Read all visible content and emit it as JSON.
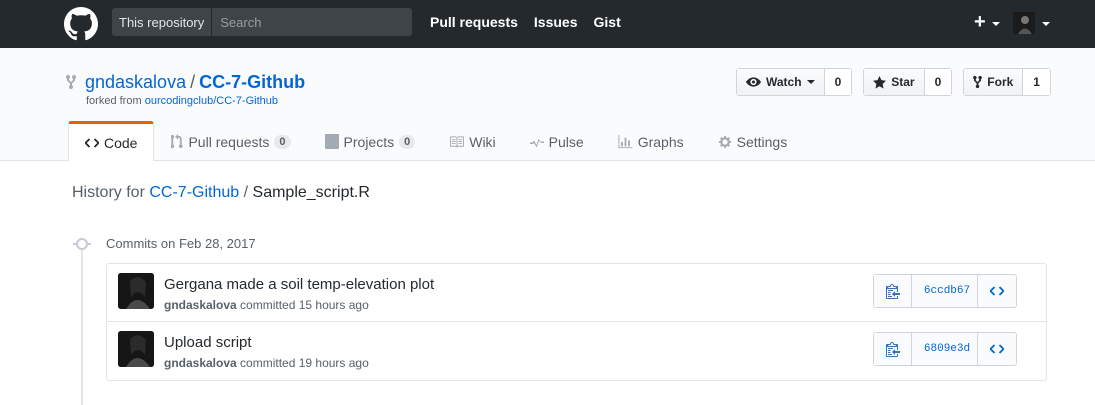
{
  "header": {
    "search_scope": "This repository",
    "search_placeholder": "Search",
    "nav": [
      "Pull requests",
      "Issues",
      "Gist"
    ]
  },
  "repo": {
    "owner": "gndaskalova",
    "separator": "/",
    "name": "CC-7-Github",
    "forked_prefix": "forked from",
    "forked_from": "ourcodingclub/CC-7-Github"
  },
  "actions": {
    "watch_label": "Watch",
    "watch_count": "0",
    "star_label": "Star",
    "star_count": "0",
    "fork_label": "Fork",
    "fork_count": "1"
  },
  "tabs": [
    {
      "label": "Code",
      "counter": null,
      "selected": true
    },
    {
      "label": "Pull requests",
      "counter": "0"
    },
    {
      "label": "Projects",
      "counter": "0"
    },
    {
      "label": "Wiki"
    },
    {
      "label": "Pulse"
    },
    {
      "label": "Graphs"
    },
    {
      "label": "Settings"
    }
  ],
  "history": {
    "prefix": "History for",
    "repo": "CC-7-Github",
    "separator": "/",
    "file": "Sample_script.R"
  },
  "commits_date": "Commits on Feb 28, 2017",
  "commits": [
    {
      "title": "Gergana made a soil temp-elevation plot",
      "author": "gndaskalova",
      "meta": "committed 15 hours ago",
      "sha": "6ccdb67"
    },
    {
      "title": "Upload script",
      "author": "gndaskalova",
      "meta": "committed 19 hours ago",
      "sha": "6809e3d"
    }
  ],
  "colors": {
    "header_bg": "#24292e",
    "link": "#0366d6",
    "tab_accent": "#e36209"
  }
}
